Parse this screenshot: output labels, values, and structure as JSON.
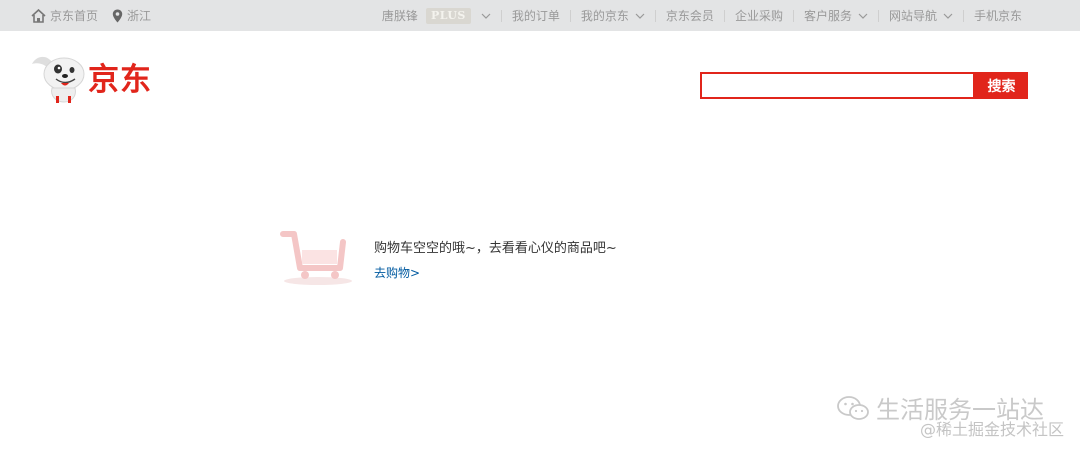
{
  "topbar": {
    "home_label": "京东首页",
    "location_label": "浙江",
    "user_name": "唐朕锋",
    "plus_badge": "PLUS",
    "nav": [
      {
        "label": "我的订单",
        "dropdown": false
      },
      {
        "label": "我的京东",
        "dropdown": true
      },
      {
        "label": "京东会员",
        "dropdown": false
      },
      {
        "label": "企业采购",
        "dropdown": false
      },
      {
        "label": "客户服务",
        "dropdown": true
      },
      {
        "label": "网站导航",
        "dropdown": true
      },
      {
        "label": "手机京东",
        "dropdown": false
      }
    ]
  },
  "header": {
    "logo_text": "京东",
    "search_value": "",
    "search_button": "搜索"
  },
  "empty_cart": {
    "message": "购物车空空的哦~，去看看心仪的商品吧~",
    "link": "去购物>"
  },
  "watermark": {
    "line1": "生活服务一站达",
    "line2": "@稀土掘金技术社区"
  },
  "colors": {
    "brand": "#e1251b",
    "link": "#005aa0",
    "topbar_bg": "#e3e4e5"
  }
}
